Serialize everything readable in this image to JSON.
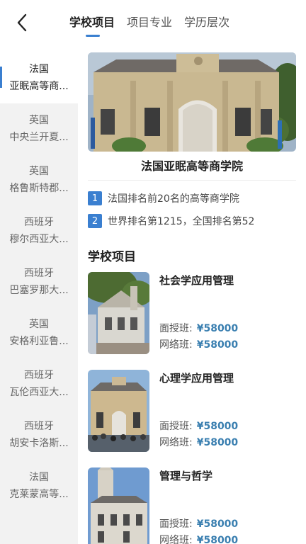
{
  "header": {
    "tabs": [
      {
        "label": "学校项目",
        "active": true
      },
      {
        "label": "项目专业",
        "active": false
      },
      {
        "label": "学历层次",
        "active": false
      }
    ]
  },
  "sidebar": {
    "items": [
      {
        "country": "法国",
        "school": "亚眠高等商...",
        "active": true
      },
      {
        "country": "英国",
        "school": "中央兰开夏..."
      },
      {
        "country": "英国",
        "school": "格鲁斯特郡..."
      },
      {
        "country": "西班牙",
        "school": "穆尔西亚大..."
      },
      {
        "country": "西班牙",
        "school": "巴塞罗那大..."
      },
      {
        "country": "英国",
        "school": "安格利亚鲁..."
      },
      {
        "country": "西班牙",
        "school": "瓦伦西亚大..."
      },
      {
        "country": "西班牙",
        "school": "胡安卡洛斯..."
      },
      {
        "country": "法国",
        "school": "克莱蒙高等..."
      }
    ]
  },
  "school": {
    "name": "法国亚眠高等商学院",
    "features": [
      {
        "num": "1",
        "text": "法国排名前20名的高等商学院"
      },
      {
        "num": "2",
        "text": "世界排名第1215，全国排名第52"
      }
    ]
  },
  "programs_section": {
    "title": "学校项目",
    "items": [
      {
        "name": "社会学应用管理",
        "face_label": "面授班:",
        "face_price": "¥58000",
        "online_label": "网络班:",
        "online_price": "¥58000"
      },
      {
        "name": "心理学应用管理",
        "face_label": "面授班:",
        "face_price": "¥58000",
        "online_label": "网络班:",
        "online_price": "¥58000"
      },
      {
        "name": "管理与哲学",
        "face_label": "面授班:",
        "face_price": "¥58000",
        "online_label": "网络班:",
        "online_price": "¥58000"
      }
    ]
  },
  "colors": {
    "accent": "#3a7fd0",
    "price": "#3a7fb0",
    "sidebar_bg": "#f2f2f2"
  }
}
